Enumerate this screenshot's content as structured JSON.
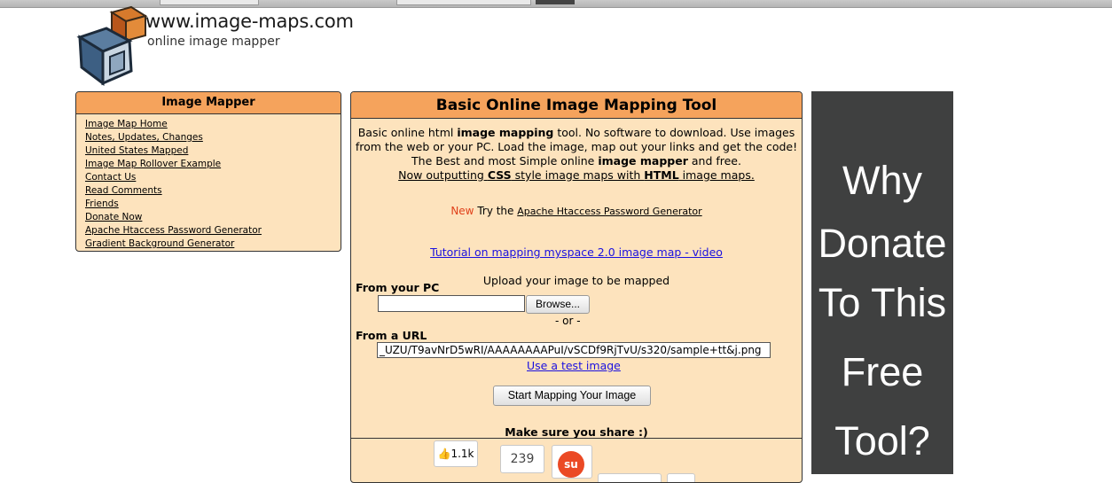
{
  "logo": {
    "url_text": "www.image-maps.com",
    "subtitle": "online image mapper"
  },
  "nav": {
    "title": "Image Mapper",
    "items": [
      {
        "label": "Image Map Home"
      },
      {
        "label": "Notes, Updates, Changes"
      },
      {
        "label": "United States Mapped"
      },
      {
        "label": "Image Map Rollover Example"
      },
      {
        "label": "Contact Us"
      },
      {
        "label": "Read Comments"
      },
      {
        "label": "Friends"
      },
      {
        "label": "Donate Now"
      },
      {
        "label": "Apache Htaccess Password Generator"
      },
      {
        "label": "Gradient Background Generator"
      }
    ]
  },
  "main": {
    "title": "Basic Online Image Mapping Tool",
    "intro": {
      "l1a": "Basic online html ",
      "l1b": "image mapping",
      "l1c": " tool. No software to download. Use images",
      "l2": "from the web or your PC. Load the image, map out your links and get the code!",
      "l3a": "The Best and most Simple online ",
      "l3b": "image mapper",
      "l3c": " and free.",
      "l4a": "Now outputting ",
      "l4b": "CSS",
      "l4c": " style image maps with ",
      "l4d": "HTML",
      "l4e": " image maps."
    },
    "new_label": "New",
    "try_text": " Try the ",
    "htaccess_link": "Apache Htaccess Password Generator",
    "tutorial_link": "Tutorial on mapping myspace 2.0 image map - video",
    "upload_label": "Upload your image to be mapped",
    "from_pc_label": "From your PC",
    "browse_label": "Browse...",
    "or_label": "- or -",
    "from_url_label": "From a URL",
    "url_value": "_UZU/T9avNrD5wRI/AAAAAAAAPuI/vSCDf9RjTvU/s320/sample+tt&j.png",
    "test_image_link": "Use a test image",
    "start_button": "Start Mapping Your Image",
    "share_label": "Make sure you share :)",
    "like_count": "1.1k",
    "share_count": "239",
    "stumble_icon": "su"
  },
  "ad": {
    "lines": [
      "Why",
      "Donate",
      "To This",
      "Free",
      "Tool?"
    ],
    "background": "#3f4040"
  },
  "colors": {
    "panel_bg": "#fde3bd",
    "header_bg": "#f5a35c",
    "link_blue": "#1a10e0",
    "new_red": "#e0401a"
  }
}
